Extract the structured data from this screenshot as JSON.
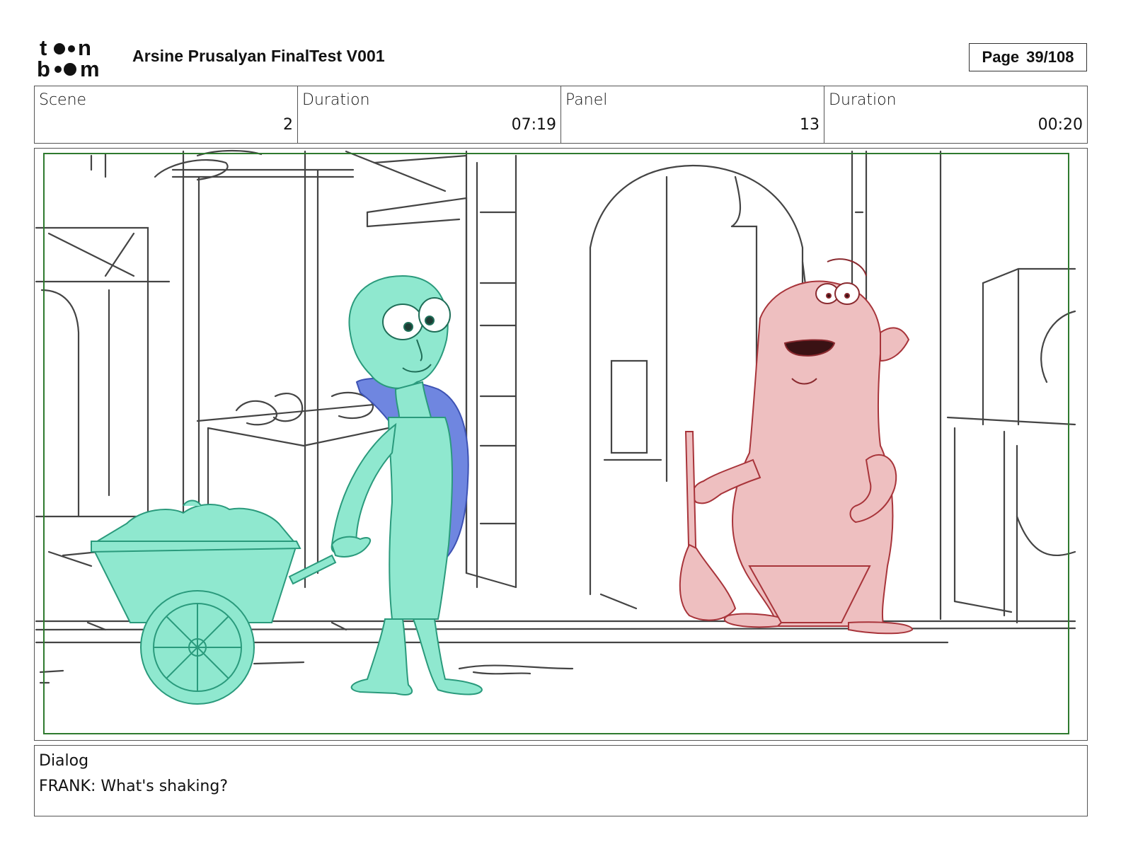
{
  "header": {
    "logo_text": "toon boom",
    "title": "Arsine Prusalyan FinalTest V001",
    "page_label": "Page",
    "page_value": "39/108"
  },
  "info": {
    "scene_label": "Scene",
    "scene_value": "2",
    "scene_duration_label": "Duration",
    "scene_duration_value": "07:19",
    "panel_label": "Panel",
    "panel_value": "13",
    "panel_duration_label": "Duration",
    "panel_duration_value": "00:20"
  },
  "panel": {
    "colors": {
      "line": "#444444",
      "green_character": "#8fe8cf",
      "green_outline": "#2a9a7c",
      "blue_character": "#6f86e0",
      "pink_character": "#eebfc0",
      "pink_outline": "#a8343a",
      "safe_frame": "#2f7a2f"
    }
  },
  "dialog": {
    "label": "Dialog",
    "text": "FRANK: What's shaking?"
  }
}
